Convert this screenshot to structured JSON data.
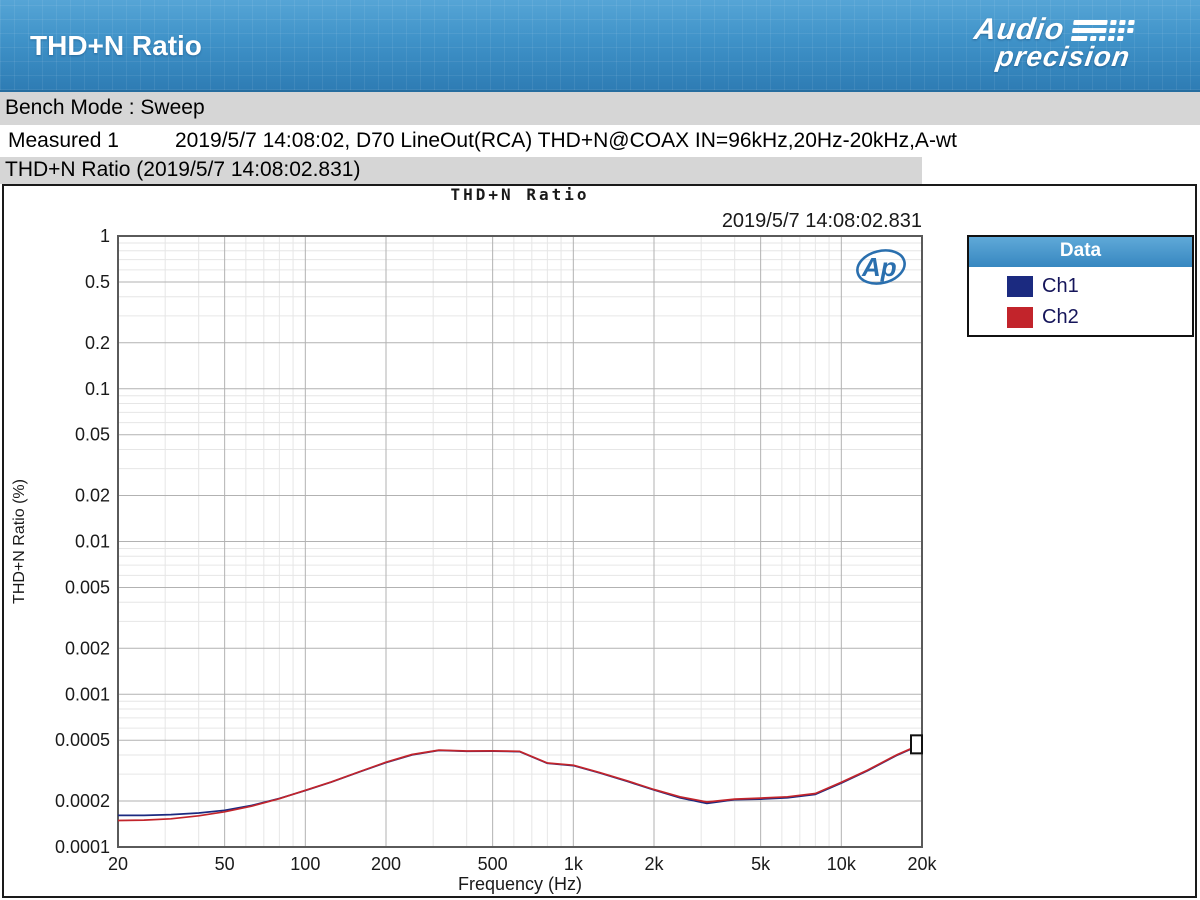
{
  "header": {
    "title": "THD+N Ratio",
    "logo_line1": "Audio",
    "logo_line2": "precision",
    "brand_blue": "#3f92c8"
  },
  "bench_mode_bar": {
    "text": "Bench Mode : Sweep"
  },
  "measured_row": {
    "label": "Measured 1",
    "details": "2019/5/7 14:08:02, D70 LineOut(RCA) THD+N@COAX IN=96kHz,20Hz-20kHz,A-wt"
  },
  "result_bar": {
    "text": "THD+N Ratio (2019/5/7 14:08:02.831)"
  },
  "chart": {
    "legend": {
      "title": "Data",
      "header_color_top": "#5fa9d8",
      "header_color_bottom": "#3787c0",
      "entries": [
        {
          "label": "Ch1",
          "color": "#1b2a80"
        },
        {
          "label": "Ch2",
          "color": "#c2242b"
        }
      ]
    },
    "ap_badge_text": "Ap",
    "ap_badge_color": "#2a6fae"
  },
  "chart_data": {
    "type": "line",
    "title": "THD+N Ratio",
    "timestamp": "2019/5/7 14:08:02.831",
    "xlabel": "Frequency (Hz)",
    "ylabel": "THD+N Ratio (%)",
    "x_scale": "log",
    "y_scale": "log",
    "xlim": [
      20,
      20000
    ],
    "ylim": [
      0.0001,
      1
    ],
    "grid": true,
    "legend_position": "top-right-outside",
    "x_ticks": [
      [
        20,
        "20"
      ],
      [
        50,
        "50"
      ],
      [
        100,
        "100"
      ],
      [
        200,
        "200"
      ],
      [
        500,
        "500"
      ],
      [
        1000,
        "1k"
      ],
      [
        2000,
        "2k"
      ],
      [
        5000,
        "5k"
      ],
      [
        10000,
        "10k"
      ],
      [
        20000,
        "20k"
      ]
    ],
    "y_ticks": [
      [
        1,
        "1"
      ],
      [
        0.5,
        "0.5"
      ],
      [
        0.2,
        "0.2"
      ],
      [
        0.1,
        "0.1"
      ],
      [
        0.05,
        "0.05"
      ],
      [
        0.02,
        "0.02"
      ],
      [
        0.01,
        "0.01"
      ],
      [
        0.005,
        "0.005"
      ],
      [
        0.002,
        "0.002"
      ],
      [
        0.001,
        "0.001"
      ],
      [
        0.0005,
        "0.0005"
      ],
      [
        0.0002,
        "0.0002"
      ],
      [
        0.0001,
        "0.0001"
      ]
    ],
    "x": [
      20,
      25,
      31.5,
      40,
      50,
      63,
      80,
      100,
      125,
      160,
      200,
      250,
      315,
      400,
      500,
      630,
      800,
      1000,
      1250,
      1600,
      2000,
      2500,
      3150,
      4000,
      5000,
      6300,
      8000,
      10000,
      12500,
      16000,
      20000
    ],
    "series": [
      {
        "name": "Ch1",
        "color": "#1b2a80",
        "values": [
          0.000161,
          0.000161,
          0.000163,
          0.000167,
          0.000174,
          0.000187,
          0.000208,
          0.000234,
          0.000266,
          0.000311,
          0.000357,
          0.000401,
          0.000429,
          0.000423,
          0.000424,
          0.000421,
          0.000353,
          0.000341,
          0.000306,
          0.000268,
          0.000236,
          0.00021,
          0.000193,
          0.000204,
          0.000206,
          0.00021,
          0.000221,
          0.000262,
          0.000315,
          0.000396,
          0.000471
        ]
      },
      {
        "name": "Ch2",
        "color": "#c2242b",
        "values": [
          0.000149,
          0.00015,
          0.000153,
          0.00016,
          0.00017,
          0.000185,
          0.000207,
          0.000235,
          0.000267,
          0.000312,
          0.000359,
          0.000403,
          0.000431,
          0.000425,
          0.000426,
          0.000423,
          0.000355,
          0.000343,
          0.000308,
          0.00027,
          0.000238,
          0.000213,
          0.000197,
          0.000206,
          0.000209,
          0.000213,
          0.000224,
          0.000265,
          0.000318,
          0.000399,
          0.000474
        ]
      }
    ],
    "end_marker": {
      "freq": 20000,
      "value": 0.00047
    }
  }
}
